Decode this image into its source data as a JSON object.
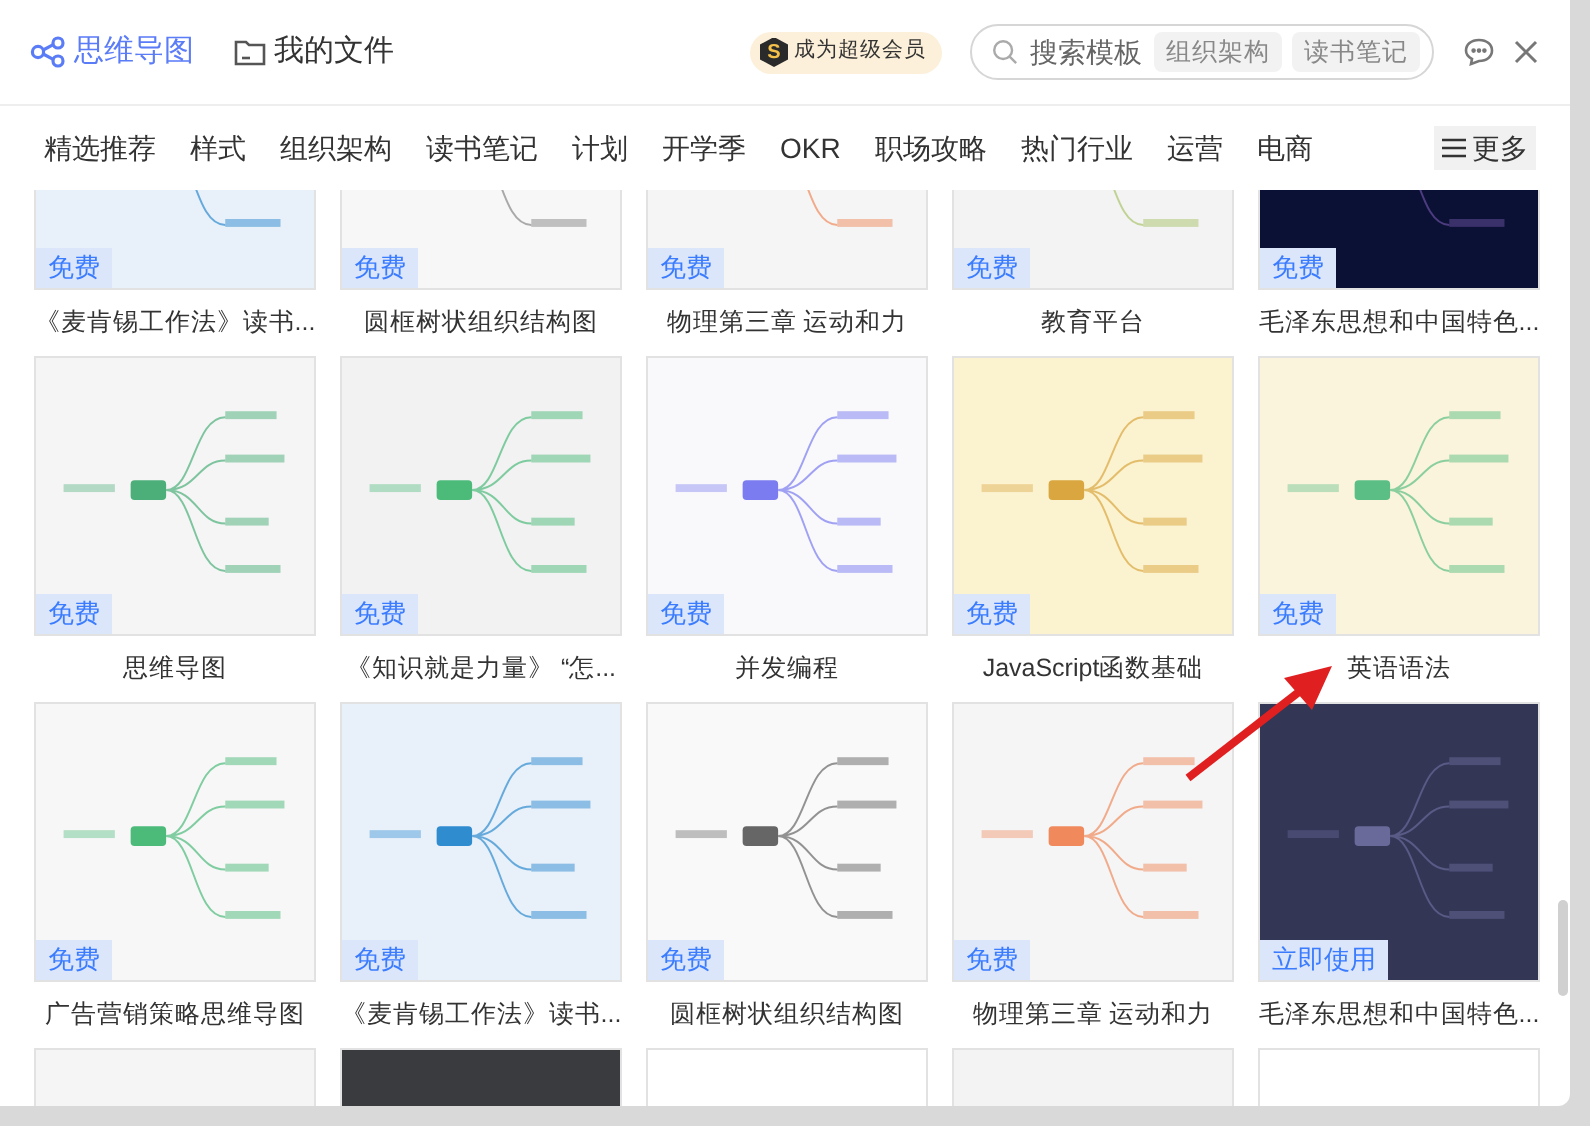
{
  "header": {
    "app_title": "思维导图",
    "files_link": "我的文件",
    "vip": {
      "mark": "S",
      "label": "成为超级会员"
    },
    "search": {
      "placeholder": "搜索模板",
      "tags": [
        "组织架构",
        "读书笔记"
      ]
    }
  },
  "categories": [
    "精选推荐",
    "样式",
    "组织架构",
    "读书笔记",
    "计划",
    "开学季",
    "OKR",
    "职场攻略",
    "热门行业",
    "运营",
    "电商"
  ],
  "more_button": "更多",
  "cards": [
    {
      "kind": "template",
      "title": "《麦肯锡工作法》读书...",
      "badge": "免费"
    },
    {
      "kind": "template",
      "title": "圆框树状组织结构图",
      "badge": "免费"
    },
    {
      "kind": "template",
      "title": "物理第三章 运动和力",
      "badge": "免费"
    },
    {
      "kind": "template",
      "title": "教育平台",
      "badge": "免费"
    },
    {
      "kind": "template",
      "title": "毛泽东思想和中国特色...",
      "badge": "免费"
    },
    {
      "kind": "template",
      "title": "思维导图",
      "badge": "免费"
    },
    {
      "kind": "template",
      "title": "《知识就是力量》 “怎...",
      "badge": "免费"
    },
    {
      "kind": "template",
      "title": "并发编程",
      "badge": "免费"
    },
    {
      "kind": "template",
      "title": "JavaScript函数基础",
      "badge": "免费"
    },
    {
      "kind": "template",
      "title": "英语语法",
      "badge": "免费"
    },
    {
      "kind": "template",
      "title": "广告营销策略思维导图",
      "badge": "免费"
    },
    {
      "kind": "template",
      "title": "《麦肯锡工作法》读书...",
      "badge": "免费"
    },
    {
      "kind": "template",
      "title": "圆框树状组织结构图",
      "badge": "免费"
    },
    {
      "kind": "template",
      "title": "物理第三章 运动和力",
      "badge": "免费"
    },
    {
      "kind": "template",
      "title": "毛泽东思想和中国特色...",
      "badge": "立即使用"
    },
    {
      "kind": "blank"
    },
    {
      "kind": "blank"
    },
    {
      "kind": "blank"
    },
    {
      "kind": "blank"
    },
    {
      "kind": "blank"
    }
  ]
}
